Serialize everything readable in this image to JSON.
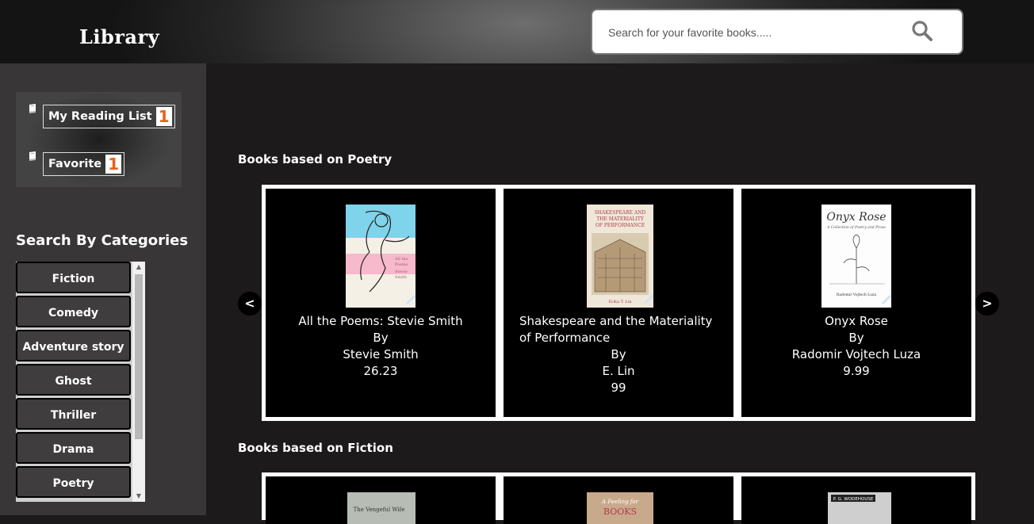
{
  "header": {
    "logo": "Library",
    "search": {
      "placeholder": "Search for your favorite books.....",
      "value": ""
    }
  },
  "sidebar": {
    "reading_list": {
      "label": "My Reading List",
      "count": "1"
    },
    "favorite": {
      "label": "Favorite",
      "count": "1"
    },
    "categories_title": "Search By Categories",
    "categories": [
      "Fiction",
      "Comedy",
      "Adventure story",
      "Ghost",
      "Thriller",
      "Drama",
      "Poetry"
    ]
  },
  "sections": [
    {
      "title": "Books based on Poetry",
      "books": [
        {
          "title": "All the Poems: Stevie Smith",
          "by": "By",
          "author": "Stevie Smith",
          "price": "26.23"
        },
        {
          "title": "Shakespeare and the Materiality of Performance",
          "by": "By",
          "author": "E. Lin",
          "price": "99"
        },
        {
          "title": "Onyx Rose",
          "by": "By",
          "author": "Radomir Vojtech Luza",
          "price": "9.99"
        }
      ]
    },
    {
      "title": "Books based on Fiction",
      "books": []
    }
  ],
  "carousel": {
    "prev_label": "<",
    "next_label": ">"
  },
  "covers": {
    "poems_cover_text": "All the Poems Stevie Smith",
    "shakespeare_cover_title": "SHAKESPEARE AND THE MATERIALITY OF PERFORMANCE",
    "shakespeare_cover_author": "Erika T. Lin",
    "onyx_cover_title": "Onyx Rose",
    "onyx_cover_subtitle": "A Collection of Poetry and Prose",
    "onyx_cover_author": "Radomir Vojtech Luza",
    "fiction1_cover": "The Vengeful Wife",
    "fiction2_cover": "A Feeling for Books",
    "fiction3_cover": "P. G. WODEHOUSE"
  },
  "colors": {
    "badge_text": "#e8611a",
    "main_bg": "#1c1a1b",
    "sidebar_bg": "#383637"
  },
  "icons": {
    "search": "search-icon",
    "book": "book-icon"
  }
}
